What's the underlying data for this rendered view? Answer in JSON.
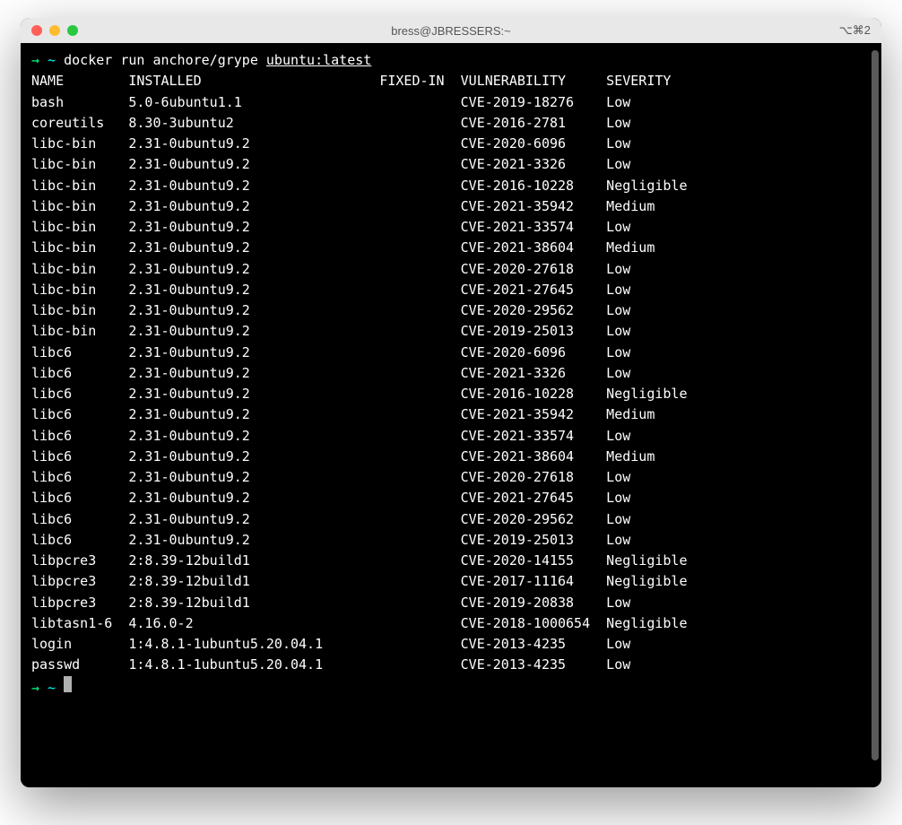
{
  "title": "bress@JBRESSERS:~",
  "title_right": "⌥⌘2",
  "prompt": {
    "arrow": "→",
    "tilde": " ~ ",
    "command": "docker run anchore/grype ",
    "arg": "ubuntu:latest"
  },
  "prompt2": {
    "arrow": "→",
    "tilde": " ~ "
  },
  "headers": {
    "name": "NAME",
    "installed": "INSTALLED",
    "fixed_in": "FIXED-IN",
    "vulnerability": "VULNERABILITY",
    "severity": "SEVERITY"
  },
  "rows": [
    {
      "name": "bash",
      "installed": "5.0-6ubuntu1.1",
      "fixed_in": "",
      "vulnerability": "CVE-2019-18276",
      "severity": "Low"
    },
    {
      "name": "coreutils",
      "installed": "8.30-3ubuntu2",
      "fixed_in": "",
      "vulnerability": "CVE-2016-2781",
      "severity": "Low"
    },
    {
      "name": "libc-bin",
      "installed": "2.31-0ubuntu9.2",
      "fixed_in": "",
      "vulnerability": "CVE-2020-6096",
      "severity": "Low"
    },
    {
      "name": "libc-bin",
      "installed": "2.31-0ubuntu9.2",
      "fixed_in": "",
      "vulnerability": "CVE-2021-3326",
      "severity": "Low"
    },
    {
      "name": "libc-bin",
      "installed": "2.31-0ubuntu9.2",
      "fixed_in": "",
      "vulnerability": "CVE-2016-10228",
      "severity": "Negligible"
    },
    {
      "name": "libc-bin",
      "installed": "2.31-0ubuntu9.2",
      "fixed_in": "",
      "vulnerability": "CVE-2021-35942",
      "severity": "Medium"
    },
    {
      "name": "libc-bin",
      "installed": "2.31-0ubuntu9.2",
      "fixed_in": "",
      "vulnerability": "CVE-2021-33574",
      "severity": "Low"
    },
    {
      "name": "libc-bin",
      "installed": "2.31-0ubuntu9.2",
      "fixed_in": "",
      "vulnerability": "CVE-2021-38604",
      "severity": "Medium"
    },
    {
      "name": "libc-bin",
      "installed": "2.31-0ubuntu9.2",
      "fixed_in": "",
      "vulnerability": "CVE-2020-27618",
      "severity": "Low"
    },
    {
      "name": "libc-bin",
      "installed": "2.31-0ubuntu9.2",
      "fixed_in": "",
      "vulnerability": "CVE-2021-27645",
      "severity": "Low"
    },
    {
      "name": "libc-bin",
      "installed": "2.31-0ubuntu9.2",
      "fixed_in": "",
      "vulnerability": "CVE-2020-29562",
      "severity": "Low"
    },
    {
      "name": "libc-bin",
      "installed": "2.31-0ubuntu9.2",
      "fixed_in": "",
      "vulnerability": "CVE-2019-25013",
      "severity": "Low"
    },
    {
      "name": "libc6",
      "installed": "2.31-0ubuntu9.2",
      "fixed_in": "",
      "vulnerability": "CVE-2020-6096",
      "severity": "Low"
    },
    {
      "name": "libc6",
      "installed": "2.31-0ubuntu9.2",
      "fixed_in": "",
      "vulnerability": "CVE-2021-3326",
      "severity": "Low"
    },
    {
      "name": "libc6",
      "installed": "2.31-0ubuntu9.2",
      "fixed_in": "",
      "vulnerability": "CVE-2016-10228",
      "severity": "Negligible"
    },
    {
      "name": "libc6",
      "installed": "2.31-0ubuntu9.2",
      "fixed_in": "",
      "vulnerability": "CVE-2021-35942",
      "severity": "Medium"
    },
    {
      "name": "libc6",
      "installed": "2.31-0ubuntu9.2",
      "fixed_in": "",
      "vulnerability": "CVE-2021-33574",
      "severity": "Low"
    },
    {
      "name": "libc6",
      "installed": "2.31-0ubuntu9.2",
      "fixed_in": "",
      "vulnerability": "CVE-2021-38604",
      "severity": "Medium"
    },
    {
      "name": "libc6",
      "installed": "2.31-0ubuntu9.2",
      "fixed_in": "",
      "vulnerability": "CVE-2020-27618",
      "severity": "Low"
    },
    {
      "name": "libc6",
      "installed": "2.31-0ubuntu9.2",
      "fixed_in": "",
      "vulnerability": "CVE-2021-27645",
      "severity": "Low"
    },
    {
      "name": "libc6",
      "installed": "2.31-0ubuntu9.2",
      "fixed_in": "",
      "vulnerability": "CVE-2020-29562",
      "severity": "Low"
    },
    {
      "name": "libc6",
      "installed": "2.31-0ubuntu9.2",
      "fixed_in": "",
      "vulnerability": "CVE-2019-25013",
      "severity": "Low"
    },
    {
      "name": "libpcre3",
      "installed": "2:8.39-12build1",
      "fixed_in": "",
      "vulnerability": "CVE-2020-14155",
      "severity": "Negligible"
    },
    {
      "name": "libpcre3",
      "installed": "2:8.39-12build1",
      "fixed_in": "",
      "vulnerability": "CVE-2017-11164",
      "severity": "Negligible"
    },
    {
      "name": "libpcre3",
      "installed": "2:8.39-12build1",
      "fixed_in": "",
      "vulnerability": "CVE-2019-20838",
      "severity": "Low"
    },
    {
      "name": "libtasn1-6",
      "installed": "4.16.0-2",
      "fixed_in": "",
      "vulnerability": "CVE-2018-1000654",
      "severity": "Negligible"
    },
    {
      "name": "login",
      "installed": "1:4.8.1-1ubuntu5.20.04.1",
      "fixed_in": "",
      "vulnerability": "CVE-2013-4235",
      "severity": "Low"
    },
    {
      "name": "passwd",
      "installed": "1:4.8.1-1ubuntu5.20.04.1",
      "fixed_in": "",
      "vulnerability": "CVE-2013-4235",
      "severity": "Low"
    }
  ],
  "col_widths": {
    "name": 12,
    "installed": 31,
    "fixed_in": 10,
    "vulnerability": 18,
    "severity": 12
  }
}
